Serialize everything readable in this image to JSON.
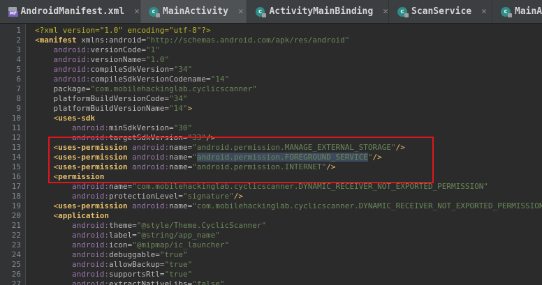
{
  "tabs": [
    {
      "label": "AndroidManifest.xml",
      "icon": "manifest-file-icon",
      "active": false,
      "close": "✕"
    },
    {
      "label": "MainActivity",
      "icon": "class-icon",
      "active": true,
      "close": "✕"
    },
    {
      "label": "ActivityMainBinding",
      "icon": "class-icon",
      "active": false,
      "close": "✕"
    },
    {
      "label": "ScanService",
      "icon": "class-icon",
      "active": false,
      "close": "✕"
    },
    {
      "label": "MainAc",
      "icon": "class-icon",
      "active": false,
      "close": ""
    }
  ],
  "icons": {
    "manifest_tag": "MF",
    "class_letter": "c"
  },
  "colors": {
    "highlight_box": "#e0151d",
    "editor_bg": "#2b2b2b"
  },
  "lines": [
    {
      "n": "1",
      "parts": [
        [
          "meta",
          "<?xml version=\"1.0\" encoding=\"utf-8\"?>"
        ]
      ]
    },
    {
      "n": "2",
      "parts": [
        [
          "punc",
          "<"
        ],
        [
          "tag",
          "manifest"
        ],
        [
          "attr",
          " xmlns:android="
        ],
        [
          "val",
          "\"http://schemas.android.com/apk/res/android\""
        ]
      ]
    },
    {
      "n": "3",
      "parts": [
        [
          "ns",
          "    android:"
        ],
        [
          "attr",
          "versionCode="
        ],
        [
          "val",
          "\"1\""
        ]
      ]
    },
    {
      "n": "4",
      "parts": [
        [
          "ns",
          "    android:"
        ],
        [
          "attr",
          "versionName="
        ],
        [
          "val",
          "\"1.0\""
        ]
      ]
    },
    {
      "n": "5",
      "parts": [
        [
          "ns",
          "    android:"
        ],
        [
          "attr",
          "compileSdkVersion="
        ],
        [
          "val",
          "\"34\""
        ]
      ]
    },
    {
      "n": "6",
      "parts": [
        [
          "ns",
          "    android:"
        ],
        [
          "attr",
          "compileSdkVersionCodename="
        ],
        [
          "val",
          "\"14\""
        ]
      ]
    },
    {
      "n": "7",
      "parts": [
        [
          "attr",
          "    package="
        ],
        [
          "val",
          "\"com.mobilehackinglab.cyclicscanner\""
        ]
      ]
    },
    {
      "n": "8",
      "parts": [
        [
          "attr",
          "    platformBuildVersionCode="
        ],
        [
          "val",
          "\"34\""
        ]
      ]
    },
    {
      "n": "9",
      "parts": [
        [
          "attr",
          "    platformBuildVersionName="
        ],
        [
          "val",
          "\"14\""
        ],
        [
          "punc",
          ">"
        ]
      ]
    },
    {
      "n": "10",
      "parts": [
        [
          "punc",
          "    <"
        ],
        [
          "tag",
          "uses-sdk"
        ]
      ]
    },
    {
      "n": "11",
      "parts": [
        [
          "ns",
          "        android:"
        ],
        [
          "attr",
          "minSdkVersion="
        ],
        [
          "val",
          "\"30\""
        ]
      ]
    },
    {
      "n": "12",
      "parts": [
        [
          "ns",
          "        android:"
        ],
        [
          "attr",
          "targetSdkVersion="
        ],
        [
          "val",
          "\"33\""
        ],
        [
          "punc",
          "/>"
        ]
      ]
    },
    {
      "n": "13",
      "parts": [
        [
          "punc",
          "    <"
        ],
        [
          "tag",
          "uses-permission"
        ],
        [
          "ns",
          " android:"
        ],
        [
          "attr",
          "name="
        ],
        [
          "val",
          "\"android.permission.MANAGE_EXTERNAL_STORAGE\""
        ],
        [
          "punc",
          "/>"
        ]
      ]
    },
    {
      "n": "14",
      "parts": [
        [
          "punc",
          "    <"
        ],
        [
          "tag",
          "uses-permission"
        ],
        [
          "ns",
          " android:"
        ],
        [
          "attr",
          "name="
        ],
        [
          "val",
          "\""
        ],
        [
          "valhl",
          "android.permission.FOREGROUND_SERVICE"
        ],
        [
          "val",
          "\""
        ],
        [
          "punc",
          "/>"
        ]
      ]
    },
    {
      "n": "15",
      "parts": [
        [
          "punc",
          "    <"
        ],
        [
          "tag",
          "uses-permission"
        ],
        [
          "ns",
          " android:"
        ],
        [
          "attr",
          "name="
        ],
        [
          "val",
          "\"android.permission.INTERNET\""
        ],
        [
          "punc",
          "/>"
        ]
      ]
    },
    {
      "n": "16",
      "parts": [
        [
          "punc",
          "    <"
        ],
        [
          "tag",
          "permission"
        ]
      ]
    },
    {
      "n": "17",
      "parts": [
        [
          "ns",
          "        android:"
        ],
        [
          "attr",
          "name="
        ],
        [
          "val",
          "\"com.mobilehackinglab.cyclicscanner.DYNAMIC_RECEIVER_NOT_EXPORTED_PERMISSION\""
        ]
      ]
    },
    {
      "n": "18",
      "parts": [
        [
          "ns",
          "        android:"
        ],
        [
          "attr",
          "protectionLevel="
        ],
        [
          "val",
          "\"signature\""
        ],
        [
          "punc",
          "/>"
        ]
      ]
    },
    {
      "n": "19",
      "parts": [
        [
          "punc",
          "    <"
        ],
        [
          "tag",
          "uses-permission"
        ],
        [
          "ns",
          " android:"
        ],
        [
          "attr",
          "name="
        ],
        [
          "val",
          "\"com.mobilehackinglab.cyclicscanner.DYNAMIC_RECEIVER_NOT_EXPORTED_PERMISSION\"/>"
        ]
      ]
    },
    {
      "n": "20",
      "parts": [
        [
          "punc",
          "    <"
        ],
        [
          "tag",
          "application"
        ]
      ]
    },
    {
      "n": "21",
      "parts": [
        [
          "ns",
          "        android:"
        ],
        [
          "attr",
          "theme="
        ],
        [
          "val",
          "\"@style/Theme.CyclicScanner\""
        ]
      ]
    },
    {
      "n": "22",
      "parts": [
        [
          "ns",
          "        android:"
        ],
        [
          "attr",
          "label="
        ],
        [
          "val",
          "\"@string/app_name\""
        ]
      ]
    },
    {
      "n": "23",
      "parts": [
        [
          "ns",
          "        android:"
        ],
        [
          "attr",
          "icon="
        ],
        [
          "val",
          "\"@mipmap/ic_launcher\""
        ]
      ]
    },
    {
      "n": "24",
      "parts": [
        [
          "ns",
          "        android:"
        ],
        [
          "attr",
          "debuggable="
        ],
        [
          "val",
          "\"true\""
        ]
      ]
    },
    {
      "n": "25",
      "parts": [
        [
          "ns",
          "        android:"
        ],
        [
          "attr",
          "allowBackup="
        ],
        [
          "val",
          "\"true\""
        ]
      ]
    },
    {
      "n": "26",
      "parts": [
        [
          "ns",
          "        android:"
        ],
        [
          "attr",
          "supportsRtl="
        ],
        [
          "val",
          "\"true\""
        ]
      ]
    },
    {
      "n": "27",
      "parts": [
        [
          "ns",
          "        android:"
        ],
        [
          "attr",
          "extractNativeLibs="
        ],
        [
          "val",
          "\"false\""
        ]
      ]
    }
  ]
}
